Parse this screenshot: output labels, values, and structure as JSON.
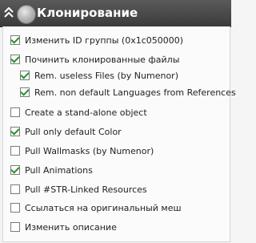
{
  "panel": {
    "title": "Клонирование"
  },
  "options": [
    {
      "label": "Изменить ID группы (0x1c050000)",
      "checked": true
    },
    {
      "label": "Починить клонированные файлы",
      "checked": true
    },
    {
      "label": "Rem. useless Files (by  Numenor)",
      "checked": true
    },
    {
      "label": "Rem. non default Languages from References",
      "checked": true
    },
    {
      "label": "Create a stand-alone object",
      "checked": false
    },
    {
      "label": "Pull only default Color",
      "checked": true
    },
    {
      "label": "Pull Wallmasks (by Numenor)",
      "checked": false
    },
    {
      "label": "Pull Animations",
      "checked": true
    },
    {
      "label": "Pull #STR-Linked Resources",
      "checked": false
    },
    {
      "label": "Ссылаться на оригинальный меш",
      "checked": false
    },
    {
      "label": "Изменить описание",
      "checked": false
    }
  ],
  "colors": {
    "titlebar": "#4a4a4a",
    "check_green": "#2a8f2a"
  },
  "icons": {
    "collapse": "chevron-up-icon",
    "title_icon": "disk-icon"
  }
}
